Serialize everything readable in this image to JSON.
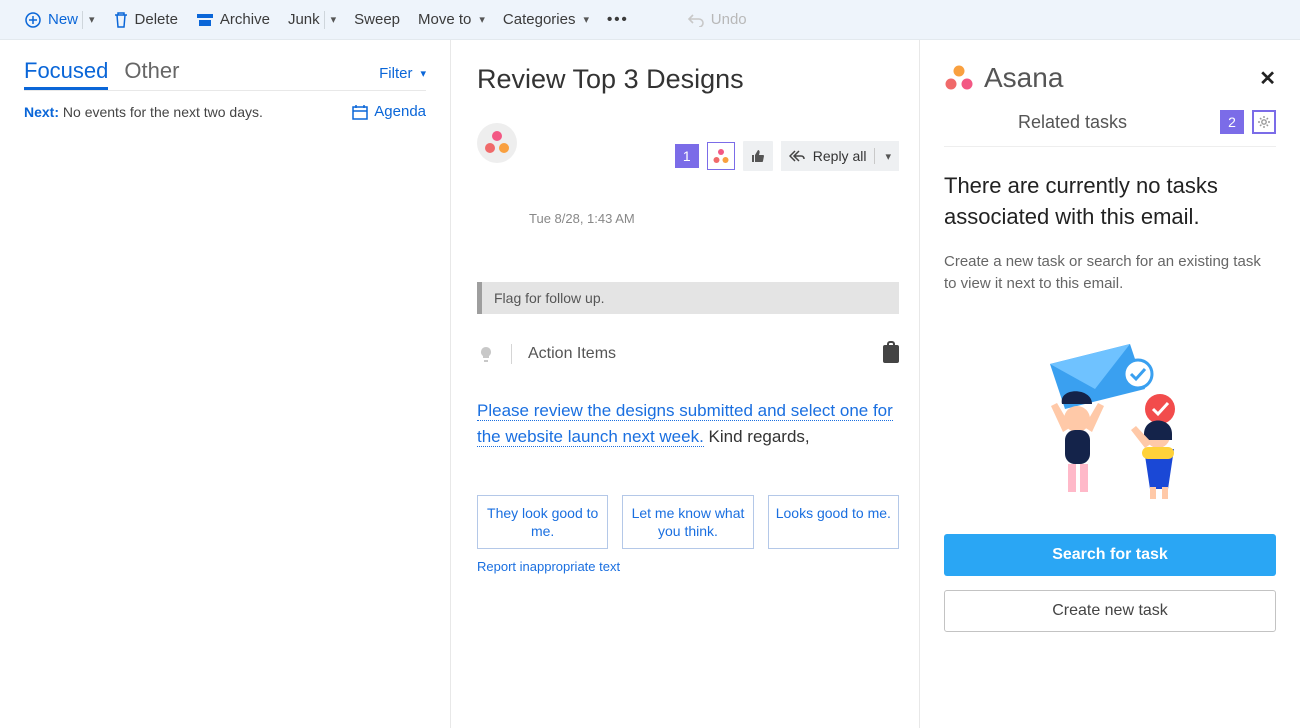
{
  "toolbar": {
    "new": "New",
    "delete": "Delete",
    "archive": "Archive",
    "junk": "Junk",
    "sweep": "Sweep",
    "move_to": "Move to",
    "categories": "Categories",
    "undo": "Undo"
  },
  "list": {
    "tab_focused": "Focused",
    "tab_other": "Other",
    "filter": "Filter",
    "next_label": "Next:",
    "next_text": "No events for the next two days.",
    "agenda": "Agenda"
  },
  "read": {
    "subject": "Review Top 3 Designs",
    "datetime": "Tue 8/28, 1:43 AM",
    "flag_text": "Flag for follow up.",
    "action_items": "Action Items",
    "body_link": "Please review the designs submitted and select one for the website launch next week.",
    "body_rest": " Kind regards,",
    "reply_all": "Reply all",
    "badge_1": "1",
    "suggestions": [
      "They look good to me.",
      "Let me know what you think.",
      "Looks good to me."
    ],
    "report": "Report inappropriate text"
  },
  "asana": {
    "brand": "Asana",
    "related": "Related tasks",
    "badge_2": "2",
    "heading": "There are currently no tasks associated with this email.",
    "sub": "Create a new task or search for an existing task to view it next to this email.",
    "btn_search": "Search for task",
    "btn_create": "Create new task"
  }
}
